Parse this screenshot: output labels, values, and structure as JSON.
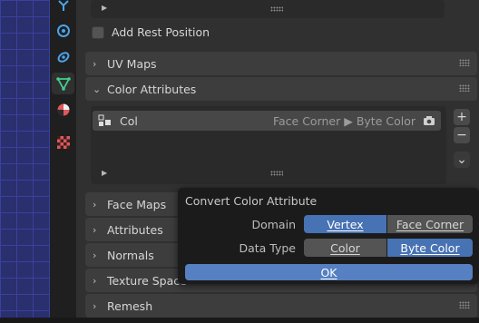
{
  "panel": {
    "add_rest_position_label": "Add Rest Position",
    "sections": [
      {
        "label": "UV Maps",
        "expanded": false
      },
      {
        "label": "Color Attributes",
        "expanded": true
      },
      {
        "label": "Face Maps",
        "expanded": false
      },
      {
        "label": "Attributes",
        "expanded": false
      },
      {
        "label": "Normals",
        "expanded": false
      },
      {
        "label": "Texture Space",
        "expanded": false
      },
      {
        "label": "Remesh",
        "expanded": false
      }
    ],
    "color_attribute_item": {
      "name": "Col",
      "domain_type": "Face Corner ▶ Byte Color"
    },
    "add_symbol": "+",
    "remove_symbol": "−",
    "more_symbol": "⌄"
  },
  "tabs": [
    {
      "icon": "particles-icon",
      "color": "#4aa3e8"
    },
    {
      "icon": "physics-icon",
      "color": "#4aa3e8"
    },
    {
      "icon": "constraints-icon",
      "color": "#4aa3e8"
    },
    {
      "icon": "mesh-data-icon",
      "color": "#3fcf8e",
      "active": true
    },
    {
      "icon": "material-icon",
      "color": "#e0585a"
    },
    {
      "icon": "texture-icon",
      "color": "#e0585a"
    }
  ],
  "popup": {
    "title": "Convert Color Attribute",
    "domain_label": "Domain",
    "domain_options": [
      "Vertex",
      "Face Corner"
    ],
    "domain_selected": "Vertex",
    "data_type_label": "Data Type",
    "data_type_options": [
      "Color",
      "Byte Color"
    ],
    "data_type_selected": "Byte Color",
    "ok_label": "OK"
  },
  "colors": {
    "accent": "#4772b3",
    "ok_button": "#5680c2",
    "panel_bg": "#303030",
    "section_bg": "#3d3d3d"
  }
}
